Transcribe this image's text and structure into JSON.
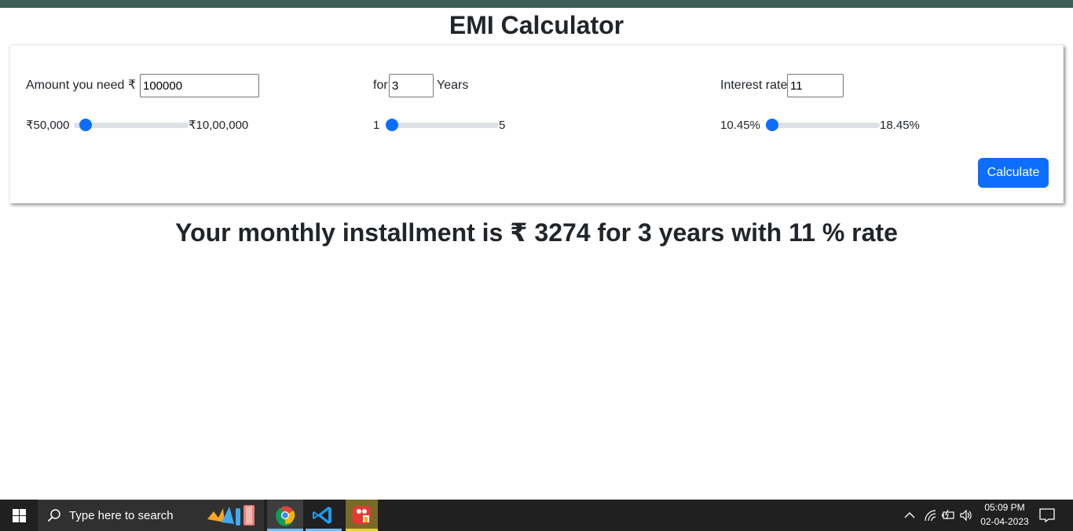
{
  "title": "EMI Calculator",
  "amount": {
    "label": "Amount you need ₹",
    "value": "100000",
    "min_label": "₹50,000",
    "max_label": "₹10,00,000",
    "slider_fraction": 0.053
  },
  "tenure": {
    "label": "for",
    "value": "3",
    "unit": "Years",
    "min_label": "1",
    "max_label": "5",
    "slider_fraction": 0.0
  },
  "interest": {
    "label": "Interest rate",
    "value": "11",
    "min_label": "10.45%",
    "max_label": "18.45%",
    "slider_fraction": 0.0
  },
  "calculate_label": "Calculate",
  "result_text": "Your monthly installment is ₹ 3274 for 3 years with 11 % rate",
  "taskbar": {
    "search_placeholder": "Type here to search",
    "apps": [
      "chrome-icon",
      "vscode-icon",
      "paint-icon"
    ],
    "time": "05:09 PM",
    "date": "02-04-2023"
  },
  "colors": {
    "accent": "#0d6efd",
    "top_strip": "#3f5c57",
    "taskbar": "#202020"
  }
}
